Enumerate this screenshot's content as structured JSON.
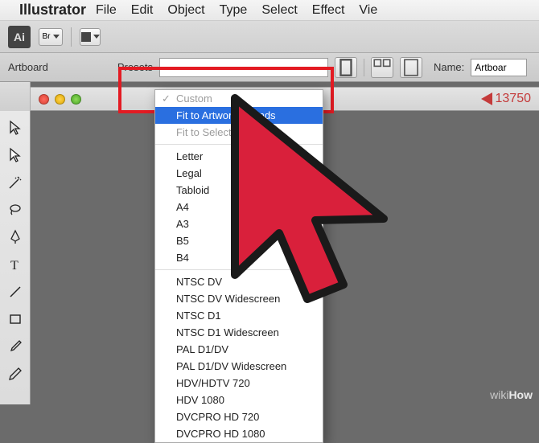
{
  "menubar": {
    "app_name": "Illustrator",
    "items": [
      "File",
      "Edit",
      "Object",
      "Type",
      "Select",
      "Effect",
      "Vie"
    ]
  },
  "appbar": {
    "logo": "Ai",
    "btn1": "Br"
  },
  "controlbar": {
    "section_label": "Artboard",
    "preset_label": "Presets",
    "name_label": "Name:",
    "name_value": "Artboar"
  },
  "dropdown": {
    "group1": [
      {
        "label": "Custom",
        "checked": true,
        "disabled": true
      },
      {
        "label": "Fit to Artwork Bounds",
        "selected": true
      },
      {
        "label": "Fit to Select",
        "disabled": true
      }
    ],
    "group2": [
      "Letter",
      "Legal",
      "Tabloid",
      "A4",
      "A3",
      "B5",
      "B4"
    ],
    "group3": [
      "NTSC DV",
      "NTSC DV Widescreen",
      "NTSC D1",
      "NTSC D1 Widescreen",
      "PAL D1/DV",
      "PAL D1/DV Widescreen",
      "HDV/HDTV 720",
      "HDV 1080",
      "DVCPRO HD 720",
      "DVCPRO HD 1080"
    ]
  },
  "docheader": {
    "zoom": "13750"
  },
  "wikihow": "wikiHow"
}
